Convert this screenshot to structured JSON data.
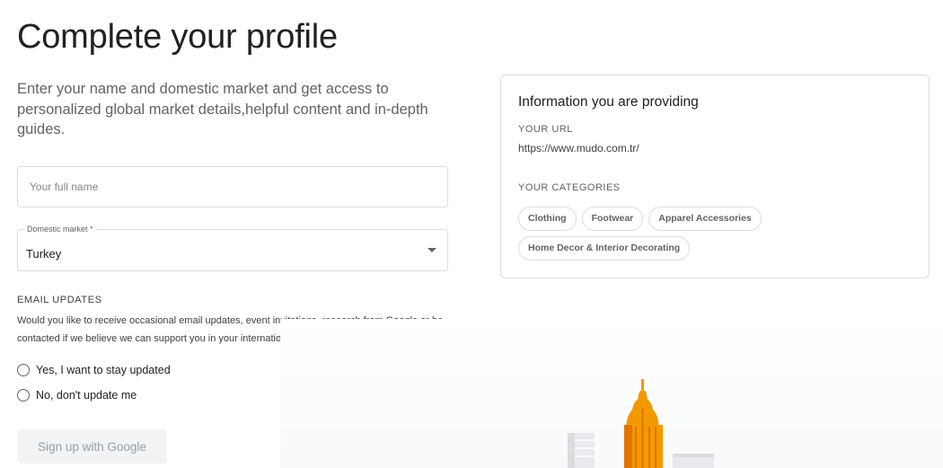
{
  "page": {
    "title": "Complete your profile",
    "intro": "Enter your name and domestic market and get access to personalized global market details,helpful content and in-depth guides."
  },
  "form": {
    "name_placeholder": "Your full name",
    "market_label": "Domestic market *",
    "market_value": "Turkey",
    "email_heading": "EMAIL UPDATES",
    "email_description": "Would you like to receive occasional email updates, event invitations, research from Google or be contacted if we believe we can support you in your international growth?",
    "options": [
      {
        "label": "Yes, I want to stay updated"
      },
      {
        "label": "No, don't update me"
      }
    ],
    "signup_label": "Sign up with Google"
  },
  "info": {
    "title": "Information you are providing",
    "url_heading": "YOUR URL",
    "url": "https://www.mudo.com.tr/",
    "categories_heading": "YOUR CATEGORIES",
    "categories": [
      "Clothing",
      "Footwear",
      "Apparel Accessories",
      "Home Decor & Interior Decorating"
    ]
  },
  "colors": {
    "building_orange": "#f29900",
    "building_dark_orange": "#e37400",
    "illustration_grey": "#e8eaed"
  },
  "icons": {
    "dropdown": "dropdown-arrow-icon"
  }
}
